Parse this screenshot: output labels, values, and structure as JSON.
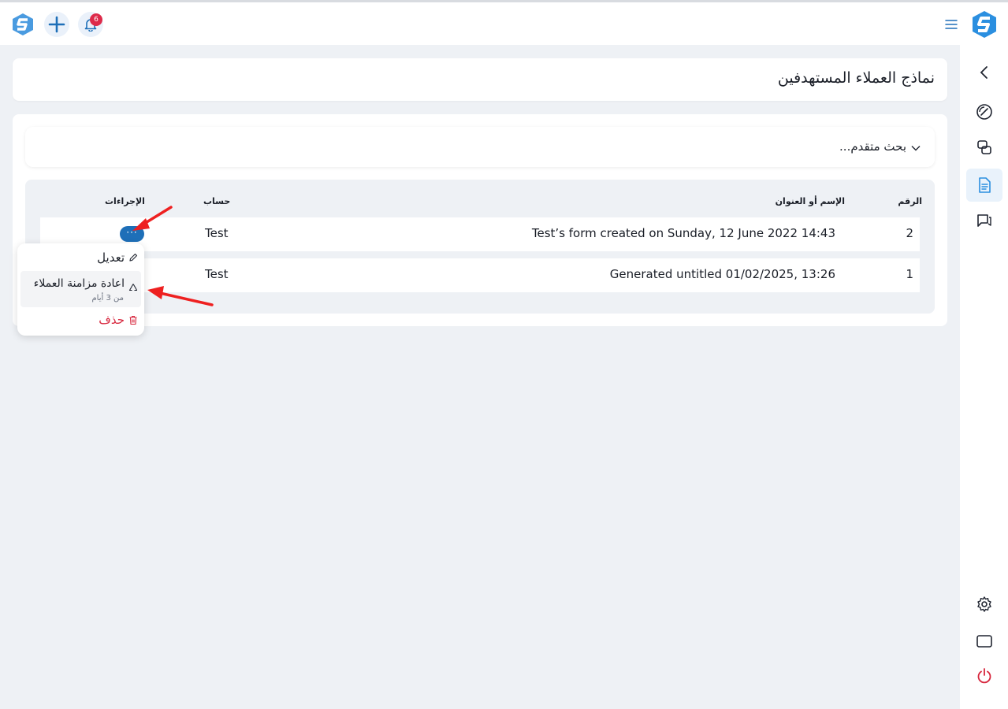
{
  "topbar": {
    "notification_count": "6"
  },
  "page": {
    "title": "نماذج العملاء المستهدفين"
  },
  "search": {
    "label": "بحث متقدم..."
  },
  "table": {
    "headers": {
      "number": "الرقم",
      "name": "الإسم أو العنوان",
      "account": "حساب",
      "actions": "الإجراءات"
    },
    "rows": [
      {
        "number": "2",
        "name": "Test’s form created on Sunday, 12 June 2022 14:43",
        "account": "Test"
      },
      {
        "number": "1",
        "name": "Generated untitled 01/02/2025, 13:26",
        "account": "Test"
      }
    ],
    "actions_button": "···"
  },
  "dropdown": {
    "edit": "تعديل",
    "sync": "اعادة مزامنة العملاء",
    "sync_sub": "من 3 أيام",
    "delete": "حذف"
  },
  "colors": {
    "accent": "#1e6fb8",
    "danger": "#d7263d",
    "badge": "#dd2a4a"
  }
}
